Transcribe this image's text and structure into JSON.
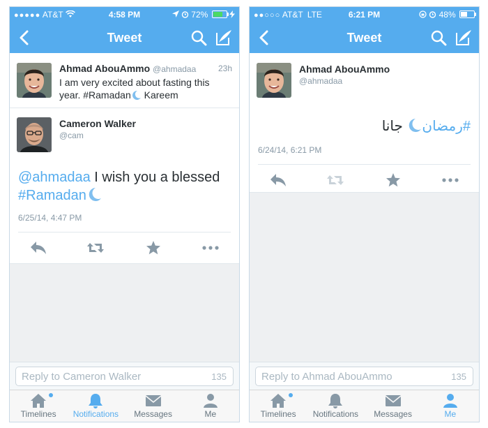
{
  "colors": {
    "twitter_blue": "#55acee",
    "text_dark": "#292f33",
    "text_gray": "#8899a6",
    "battery_green": "#4cd964"
  },
  "left": {
    "status": {
      "carrier": "AT&T",
      "time": "4:58 PM",
      "battery": "72%",
      "battery_level": 0.72,
      "battery_color": "#4cd964"
    },
    "nav": {
      "title": "Tweet",
      "back_icon": "chevron-left-icon",
      "search_icon": "search-icon",
      "compose_icon": "compose-icon"
    },
    "context_tweet": {
      "name": "Ahmad AbouAmmo",
      "handle": "@ahmadaa",
      "time": "23h",
      "text_line1": "I am very excited about fasting this",
      "text_line2_pre": "year. #Ramadan",
      "text_line2_post": " Kareem"
    },
    "main_tweet": {
      "name": "Cameron Walker",
      "handle": "@cam",
      "mention": "@ahmadaa",
      "text_mid": " I wish you a blessed",
      "hashtag": "#Ramadan",
      "date": "6/25/14, 4:47 PM"
    },
    "reply": {
      "placeholder": "Reply to Cameron Walker",
      "count": "135"
    },
    "tabs": [
      {
        "label": "Timelines",
        "icon": "home-icon"
      },
      {
        "label": "Notifications",
        "icon": "bell-icon"
      },
      {
        "label": "Messages",
        "icon": "envelope-icon"
      },
      {
        "label": "Me",
        "icon": "person-icon"
      }
    ],
    "active_tab": "Notifications"
  },
  "right": {
    "status": {
      "carrier": "AT&T",
      "network": "LTE",
      "time": "6:21 PM",
      "battery": "48%",
      "battery_level": 0.48,
      "battery_color": "#ffffff"
    },
    "nav": {
      "title": "Tweet"
    },
    "main_tweet": {
      "name": "Ahmad AbouAmmo",
      "handle": "@ahmadaa",
      "hashtag": "#رمضان",
      "text": "جانا",
      "date": "6/24/14, 6:21 PM"
    },
    "reply": {
      "placeholder": "Reply to Ahmad AbouAmmo",
      "count": "135"
    },
    "tabs": [
      {
        "label": "Timelines",
        "icon": "home-icon"
      },
      {
        "label": "Notifications",
        "icon": "bell-icon"
      },
      {
        "label": "Messages",
        "icon": "envelope-icon"
      },
      {
        "label": "Me",
        "icon": "person-icon"
      }
    ],
    "active_tab": "Me"
  }
}
